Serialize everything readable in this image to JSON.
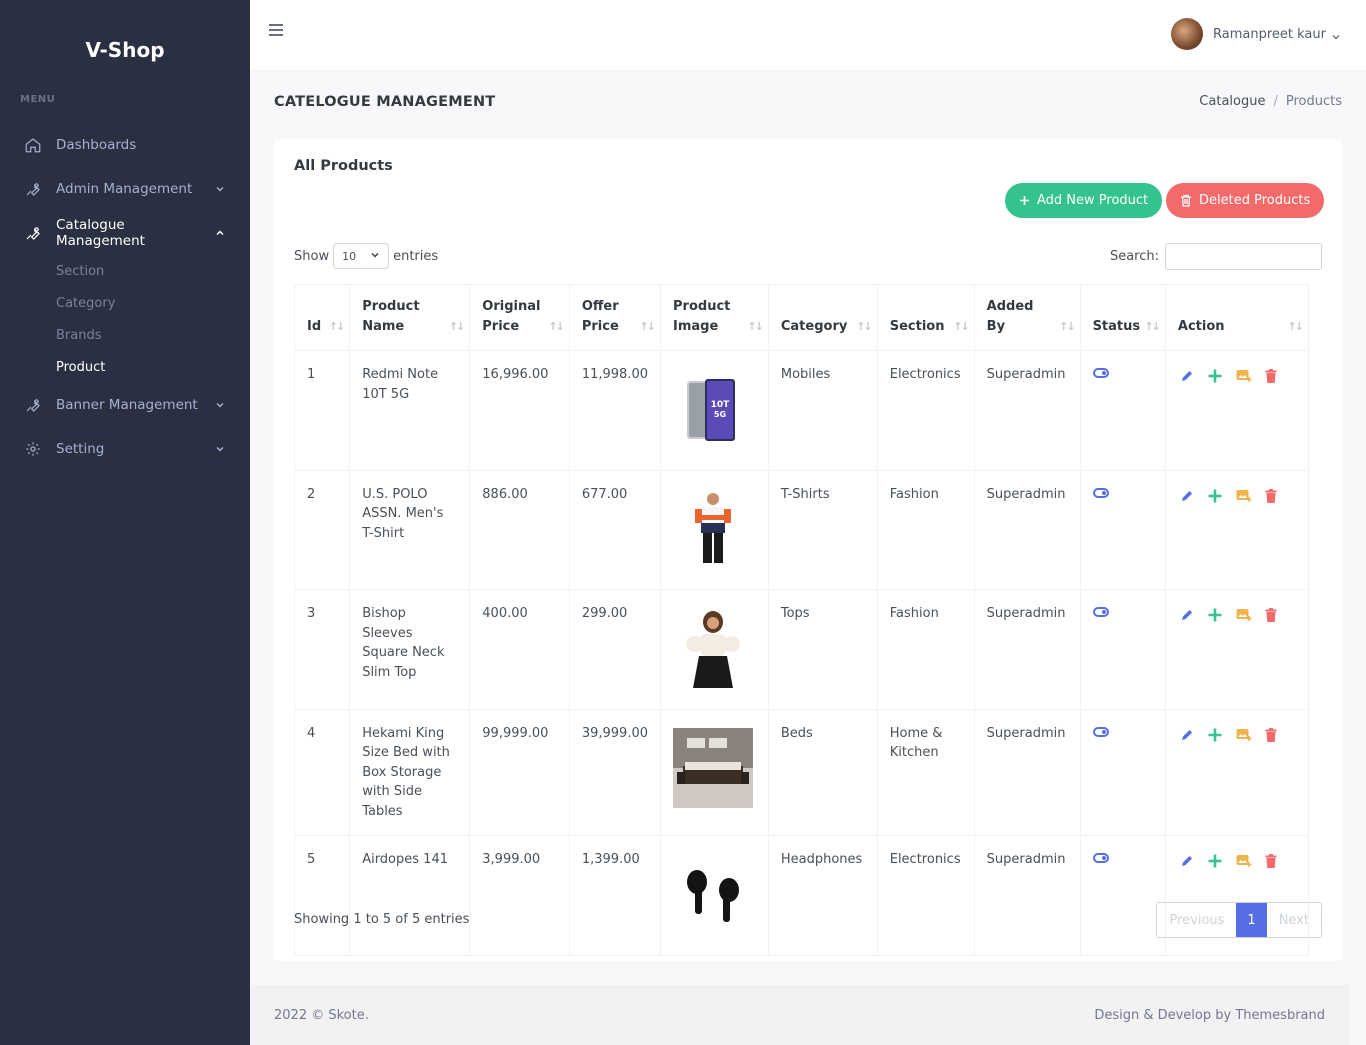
{
  "app": {
    "name": "V-Shop"
  },
  "sidebar": {
    "menu_title": "MENU",
    "items": [
      {
        "label": "Dashboards"
      },
      {
        "label": "Admin Management"
      },
      {
        "label": "Catalogue Management"
      },
      {
        "label": "Banner Management"
      },
      {
        "label": "Setting"
      }
    ],
    "sub_items": [
      {
        "label": "Section"
      },
      {
        "label": "Category"
      },
      {
        "label": "Brands"
      },
      {
        "label": "Product"
      }
    ]
  },
  "header": {
    "user_name": "Ramanpreet kaur"
  },
  "page": {
    "title": "CATELOGUE MANAGEMENT",
    "breadcrumb": [
      "Catalogue",
      "Products"
    ]
  },
  "card": {
    "title": "All Products",
    "add_button": "Add New Product",
    "deleted_button": "Deleted Products",
    "show_label": "Show",
    "entries_value": "10",
    "entries_label": "entries",
    "search_label": "Search:",
    "search_value": ""
  },
  "table": {
    "columns": [
      {
        "line1": "Id",
        "line2": ""
      },
      {
        "line1": "Product",
        "line2": "Name"
      },
      {
        "line1": "Original",
        "line2": "Price"
      },
      {
        "line1": "Offer",
        "line2": "Price"
      },
      {
        "line1": "Product",
        "line2": "Image"
      },
      {
        "line1": "Category",
        "line2": ""
      },
      {
        "line1": "Section",
        "line2": ""
      },
      {
        "line1": "Added",
        "line2": "By"
      },
      {
        "line1": "Status",
        "line2": ""
      },
      {
        "line1": "Action",
        "line2": ""
      }
    ],
    "rows": [
      {
        "id": "1",
        "name": "Redmi Note 10T 5G",
        "original": "16,996.00",
        "offer": "11,998.00",
        "image": "phone-image",
        "category": "Mobiles",
        "section": "Electronics",
        "added_by": "Superadmin",
        "status": "active"
      },
      {
        "id": "2",
        "name": "U.S. POLO ASSN. Men's T-Shirt",
        "original": "886.00",
        "offer": "677.00",
        "image": "tshirt-image",
        "category": "T-Shirts",
        "section": "Fashion",
        "added_by": "Superadmin",
        "status": "active"
      },
      {
        "id": "3",
        "name": "Bishop Sleeves Square Neck Slim Top",
        "original": "400.00",
        "offer": "299.00",
        "image": "top-image",
        "category": "Tops",
        "section": "Fashion",
        "added_by": "Superadmin",
        "status": "active"
      },
      {
        "id": "4",
        "name": "Hekami King Size Bed with Box Storage with Side Tables",
        "original": "99,999.00",
        "offer": "39,999.00",
        "image": "bed-image",
        "category": "Beds",
        "section": "Home & Kitchen",
        "added_by": "Superadmin",
        "status": "active"
      },
      {
        "id": "5",
        "name": "Airdopes 141",
        "original": "3,999.00",
        "offer": "1,399.00",
        "image": "earbuds-image",
        "category": "Headphones",
        "section": "Electronics",
        "added_by": "Superadmin",
        "status": "active"
      }
    ]
  },
  "pagination": {
    "info": "Showing 1 to 5 of 5 entries",
    "previous": "Previous",
    "page": "1",
    "next": "Next"
  },
  "footer": {
    "left": "2022 © Skote.",
    "right": "Design & Develop by Themesbrand"
  },
  "colors": {
    "sidebar_bg": "#2a3042",
    "primary": "#556ee6",
    "success": "#34c38f",
    "danger": "#f46a6a",
    "warning": "#f1b44c"
  }
}
